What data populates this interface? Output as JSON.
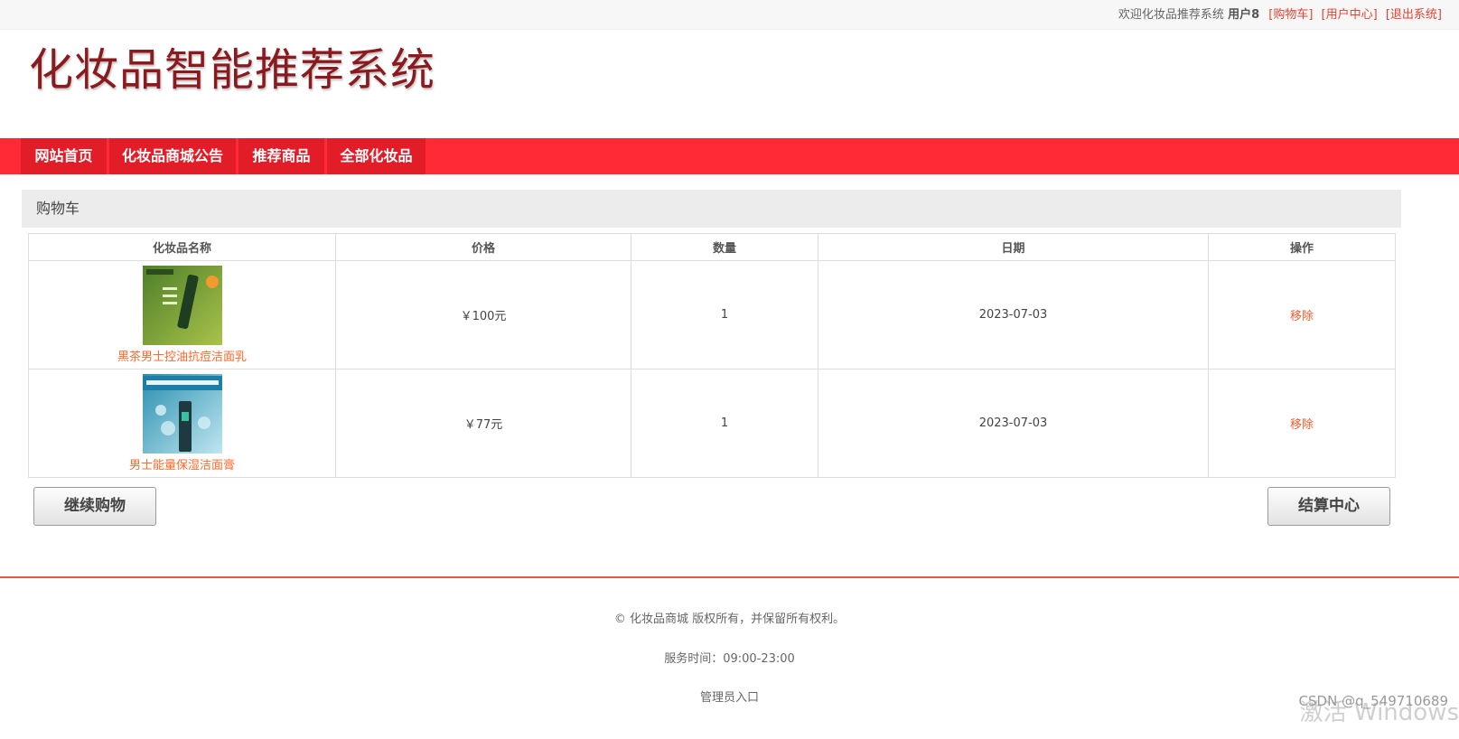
{
  "topbar": {
    "welcome": "欢迎化妆品推荐系统",
    "username": "用户8",
    "cart_link": "[购物车]",
    "user_center_link": "[用户中心]",
    "logout_link": "[退出系统]"
  },
  "logo": {
    "title": "化妆品智能推荐系统"
  },
  "nav": {
    "items": [
      {
        "label": "网站首页"
      },
      {
        "label": "化妆品商城公告"
      },
      {
        "label": "推荐商品"
      },
      {
        "label": "全部化妆品"
      }
    ]
  },
  "cart": {
    "title": "购物车",
    "columns": [
      "化妆品名称",
      "价格",
      "数量",
      "日期",
      "操作"
    ],
    "rows": [
      {
        "name": "黑茶男士控油抗痘洁面乳",
        "price": "￥100元",
        "quantity": "1",
        "date": "2023-07-03",
        "action": "移除",
        "img_colors": [
          "#4e7f2a",
          "#a9c24a"
        ]
      },
      {
        "name": "男士能量保湿洁面膏",
        "price": "￥77元",
        "quantity": "1",
        "date": "2023-07-03",
        "action": "移除",
        "img_colors": [
          "#2a8fb0",
          "#bfe6f0"
        ]
      }
    ],
    "continue_label": "继续购物",
    "checkout_label": "结算中心"
  },
  "footer": {
    "copyright": "© 化妆品商城 版权所有，并保留所有权利。",
    "service_time": "服务时间：09:00-23:00",
    "admin_link": "管理员入口"
  },
  "watermarks": {
    "csdn": "CSDN @q_549710689",
    "windows": "激活 Windows"
  }
}
